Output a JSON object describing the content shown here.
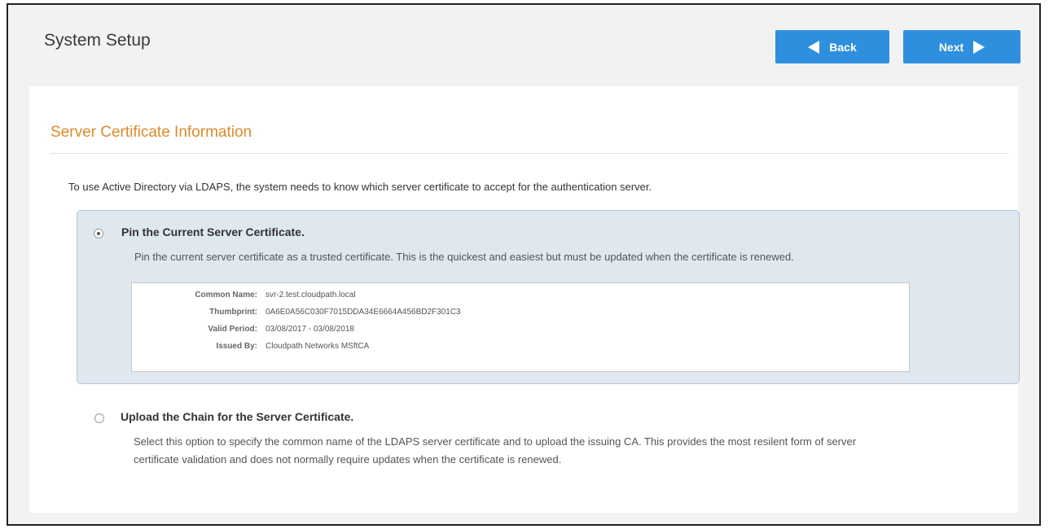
{
  "header": {
    "title": "System Setup",
    "back_label": "Back",
    "next_label": "Next"
  },
  "section": {
    "title": "Server Certificate Information",
    "intro": "To use Active Directory via LDAPS, the system needs to know which server certificate to accept for the authentication server."
  },
  "options": [
    {
      "selected": true,
      "title": "Pin the Current Server Certificate.",
      "description": "Pin the current server certificate as a trusted certificate. This is the quickest and easiest but must be updated when the certificate is renewed."
    },
    {
      "selected": false,
      "title": "Upload the Chain for the Server Certificate.",
      "description_line1": "Select this option to specify the common name of the LDAPS server certificate and to upload the issuing CA. This provides the most resilent form of server",
      "description_line2": "certificate validation and does not normally require updates when the certificate is renewed."
    }
  ],
  "certificate": {
    "rows": [
      {
        "label": "Common Name:",
        "value": "svr-2.test.cloudpath.local"
      },
      {
        "label": "Thumbprint:",
        "value": "0A6E0A56C030F7015DDA34E6664A456BD2F301C3"
      },
      {
        "label": "Valid Period:",
        "value": "03/08/2017 - 03/08/2018"
      },
      {
        "label": "Issued By:",
        "value": "Cloudpath Networks MSftCA"
      }
    ]
  },
  "colors": {
    "accent_button": "#2f8fdf",
    "section_title": "#e08a2a",
    "selected_option_bg": "#dfe7ef"
  },
  "icons": {
    "back": "triangle-left-icon",
    "next": "triangle-right-icon"
  }
}
